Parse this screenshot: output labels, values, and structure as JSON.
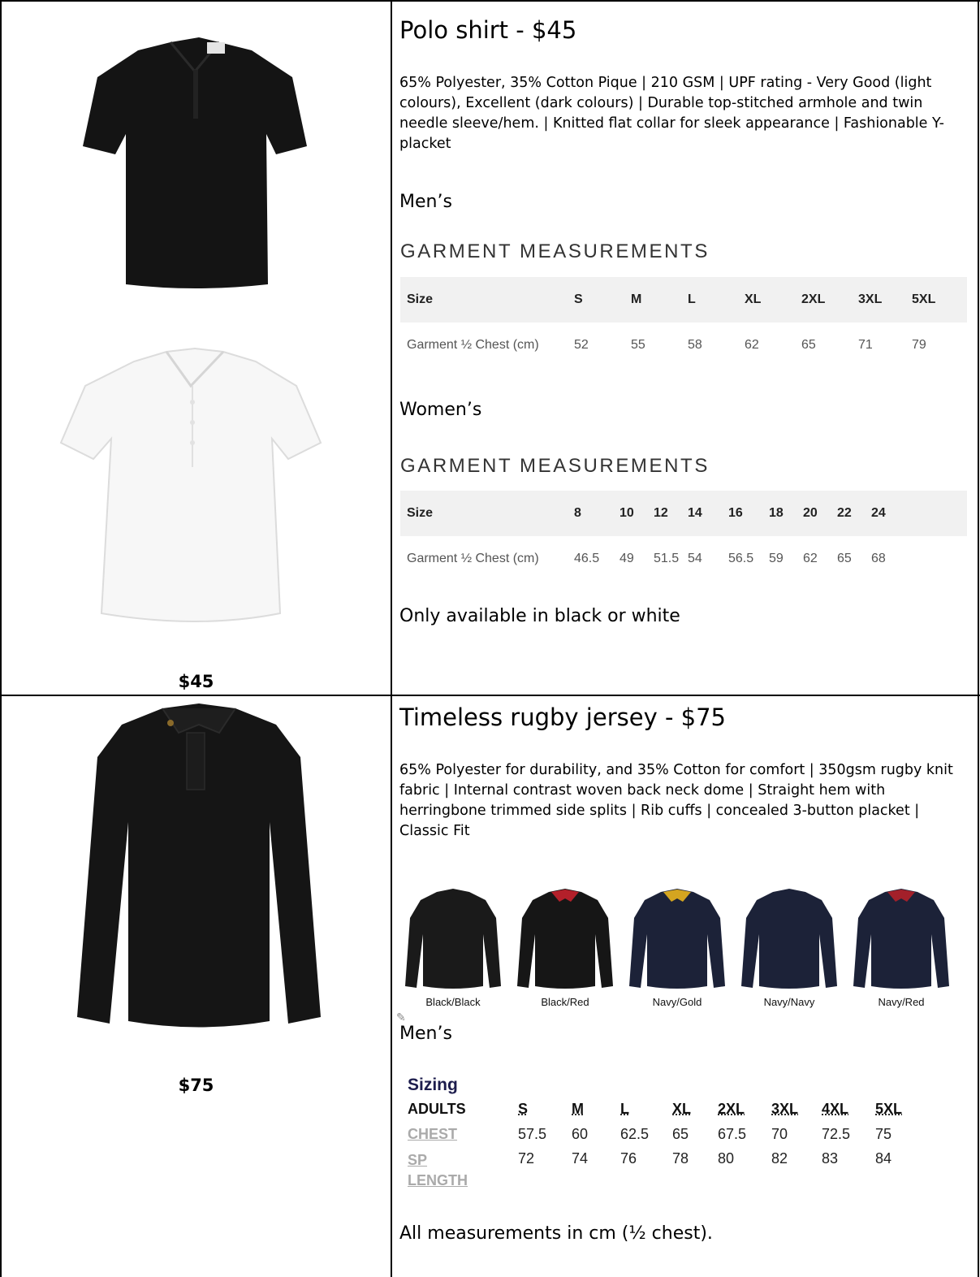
{
  "product1": {
    "title": "Polo shirt - $45",
    "description": "65% Polyester, 35% Cotton Pique | 210 GSM | UPF rating - Very Good (light colours), Excellent (dark colours) | Durable top-stitched armhole and twin needle sleeve/hem. | Knitted flat collar for sleek appearance | Fashionable Y-placket",
    "price": "$45",
    "mens_label": "Men’s",
    "womens_label": "Women’s",
    "measure_heading": "GARMENT MEASUREMENTS",
    "mens_table": {
      "header": [
        "Size",
        "S",
        "M",
        "L",
        "XL",
        "2XL",
        "3XL",
        "5XL"
      ],
      "row": [
        "Garment ½ Chest (cm)",
        "52",
        "55",
        "58",
        "62",
        "65",
        "71",
        "79"
      ]
    },
    "womens_table": {
      "header": [
        "Size",
        "8",
        "10",
        "12",
        "14",
        "16",
        "18",
        "20",
        "22",
        "24"
      ],
      "row": [
        "Garment ½ Chest (cm)",
        "46.5",
        "49",
        "51.5",
        "54",
        "56.5",
        "59",
        "62",
        "65",
        "68"
      ]
    },
    "availability": "Only available in black or white"
  },
  "product2": {
    "title": "Timeless rugby jersey - $75",
    "description": "65% Polyester for durability, and 35% Cotton for comfort | 350gsm rugby knit fabric | Internal contrast woven back neck dome | Straight hem with herringbone trimmed side splits | Rib cuffs | concealed 3-button placket | Classic Fit",
    "price": "$75",
    "colours": [
      {
        "name": "Black/Black",
        "body": "#1a1a1a",
        "accent": "#1a1a1a"
      },
      {
        "name": "Black/Red",
        "body": "#161616",
        "accent": "#b3202a"
      },
      {
        "name": "Navy/Gold",
        "body": "#1c2238",
        "accent": "#d4a520"
      },
      {
        "name": "Navy/Navy",
        "body": "#1c2238",
        "accent": "#1c2238"
      },
      {
        "name": "Navy/Red",
        "body": "#1c2238",
        "accent": "#a3202a"
      }
    ],
    "mens_label": "Men’s",
    "sizing": {
      "heading": "Sizing",
      "adults_label": "ADULTS",
      "sizes": [
        "S",
        "M",
        "L",
        "XL",
        "2XL",
        "3XL",
        "4XL",
        "5XL"
      ],
      "chest_label": "CHEST",
      "chest": [
        "57.5",
        "60",
        "62.5",
        "65",
        "67.5",
        "70",
        "72.5",
        "75"
      ],
      "length_label_1": "SP",
      "length_label_2": "LENGTH",
      "length": [
        "72",
        "74",
        "76",
        "78",
        "80",
        "82",
        "83",
        "84"
      ]
    },
    "note": "All measurements in cm (½ chest)."
  },
  "colors": {
    "black_shirt": "#141414",
    "white_shirt": "#f7f7f7",
    "table_header_bg": "#f1f1f1",
    "sizing_heading": "#1d1d4d"
  }
}
